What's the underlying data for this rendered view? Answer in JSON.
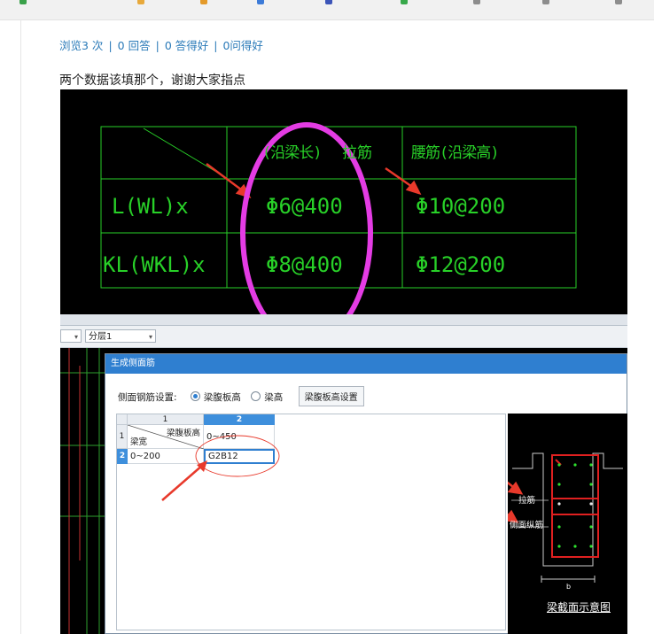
{
  "stats": {
    "views": "浏览3 次",
    "answers": "0 回答",
    "good_answers": "0 答得好",
    "good_questions": "0问得好",
    "sep": "|"
  },
  "question": "两个数据该填那个，谢谢大家指点",
  "cad_table": {
    "header_long": "(沿梁长)",
    "header_tie": "拉筋",
    "header_waist": "腰筋(沿梁高)",
    "row1_label": "L(WL)x",
    "row1_tie": "Φ6@400",
    "row1_waist": "Φ10@200",
    "row2_label": "KL(WKL)x",
    "row2_tie": "Φ8@400",
    "row2_waist": "Φ12@200"
  },
  "software": {
    "layer_combo": "分层1",
    "dialog_title": "生成侧面筋",
    "setting_label": "侧面钢筋设置:",
    "radio_1": "梁腹板高",
    "radio_2": "梁高",
    "radio_selected": "梁腹板高",
    "setting_button": "梁腹板高设置",
    "grid": {
      "col1_header": "1",
      "col2_header": "2",
      "row1_header": "1",
      "row2_header": "2",
      "diag_top": "梁腹板高",
      "diag_bottom": "梁宽",
      "range_header": "0~450",
      "row_label": "0~200",
      "value": "G2B12"
    },
    "preview": {
      "label_tie": "拉筋",
      "label_side": "侧面纵筋",
      "label_b": "b",
      "caption": "梁截面示意图"
    }
  },
  "colors": {
    "link_blue": "#2a7ab8",
    "cad_green": "#28d028",
    "highlight_magenta": "#e43ce4",
    "arrow_red": "#e8392b",
    "dialog_title_blue": "#2f7fd0"
  }
}
